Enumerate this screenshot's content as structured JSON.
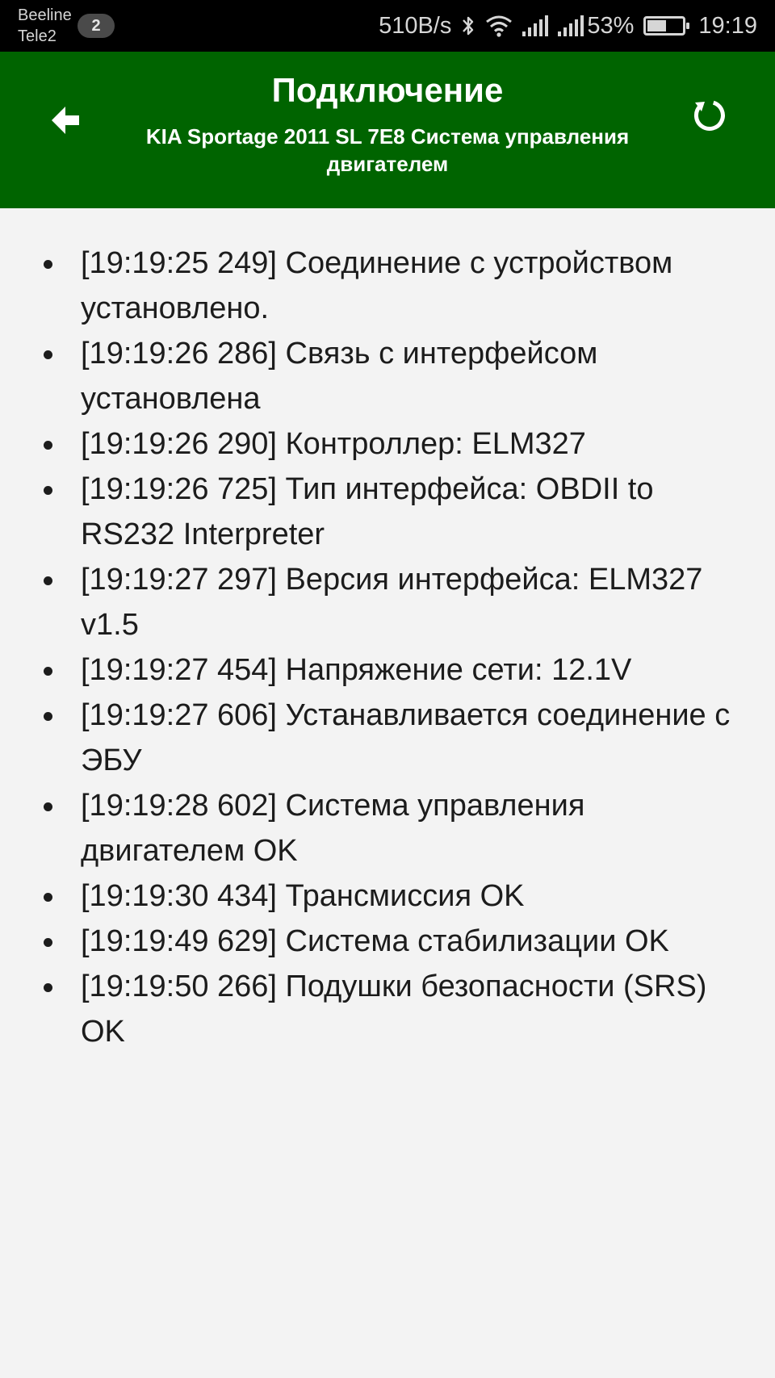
{
  "status_bar": {
    "carrier_1": "Beeline",
    "carrier_2": "Tele2",
    "notification_count": "2",
    "net_speed": "510B/s",
    "battery_percent": "53%",
    "battery_level": 0.53,
    "time": "19:19",
    "icons": [
      "bluetooth-icon",
      "wifi-icon",
      "signal-icon",
      "signal-icon",
      "battery-icon"
    ]
  },
  "app_bar": {
    "title": "Подключение",
    "subtitle": "KIA Sportage 2011 SL 7E8 Система управления двигателем",
    "back_icon": "arrow-left-icon",
    "refresh_icon": "refresh-icon",
    "background_color": "#006400"
  },
  "log": [
    "[19:19:25 249] Соединение с устройством установлено.",
    "[19:19:26 286] Связь с интерфейсом установлена",
    "[19:19:26 290] Контроллер: ELM327",
    "[19:19:26 725] Тип интерфейса: OBDII to RS232 Interpreter",
    "[19:19:27 297] Версия интерфейса: ELM327 v1.5",
    "[19:19:27 454] Напряжение сети: 12.1V",
    "[19:19:27 606] Устанавливается соединение с ЭБУ",
    "[19:19:28 602] Система управления двигателем OK",
    "[19:19:30 434] Трансмиссия OK",
    "[19:19:49 629] Система стабилизации OK",
    "[19:19:50 266] Подушки безопасности (SRS) OK"
  ]
}
